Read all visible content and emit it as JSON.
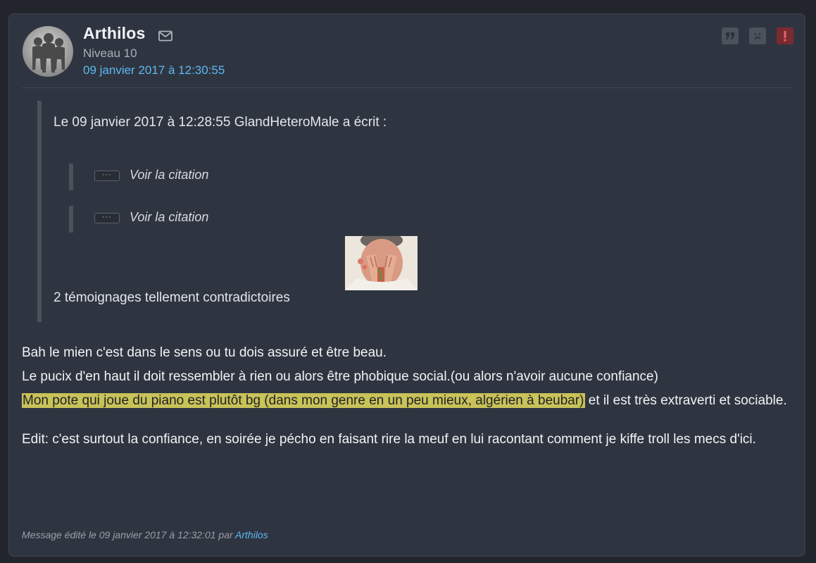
{
  "post": {
    "author": "Arthilos",
    "level": "Niveau 10",
    "date": "09 janvier 2017 à 12:30:55",
    "actions": [
      {
        "name": "quote",
        "icon": "quote-icon"
      },
      {
        "name": "sad",
        "icon": "sad-face-icon"
      },
      {
        "name": "report",
        "icon": "alert-icon"
      }
    ]
  },
  "quote": {
    "header": "Le 09 janvier 2017 à 12:28:55 GlandHeteroMale a écrit :",
    "nested": [
      {
        "dots": "···",
        "label": "Voir la citation"
      },
      {
        "dots": "···",
        "label": "Voir la citation"
      }
    ],
    "text": "2 témoignages tellement contradictoires"
  },
  "body": {
    "line1": "Bah le mien c'est dans le sens ou tu dois assuré et être beau.",
    "line2": "Le pucix d'en haut il doit ressembler à rien ou alors être phobique social.(ou alors n'avoir aucune confiance)",
    "highlighted": "Mon pote qui joue du piano est plutôt bg (dans mon genre en un peu mieux, algérien à beubar)",
    "after_highlight": " et il est très extraverti et sociable.",
    "edit": "Edit: c'est surtout la confiance, en soirée je pécho en faisant rire la meuf en lui racontant comment je kiffe troll les mecs d'ici."
  },
  "footer": {
    "prefix": "Message édité le 09 janvier 2017 à 12:32:01 par ",
    "author": "Arthilos"
  },
  "colors": {
    "background": "#22252b",
    "card": "#2f3540",
    "link": "#5cb8f3",
    "highlight": "#c9c259",
    "report": "#7a2a31"
  }
}
